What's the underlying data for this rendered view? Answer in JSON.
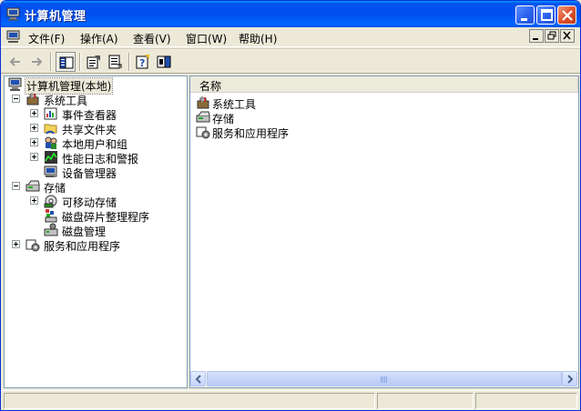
{
  "window": {
    "title": "计算机管理",
    "accent": "#0053ee",
    "close_color": "#e2532f"
  },
  "menu": {
    "items": [
      {
        "label": "文件(F)"
      },
      {
        "label": "操作(A)"
      },
      {
        "label": "查看(V)"
      },
      {
        "label": "窗口(W)"
      },
      {
        "label": "帮助(H)"
      }
    ]
  },
  "toolbar": {
    "buttons": [
      {
        "icon": "back-arrow-icon"
      },
      {
        "icon": "forward-arrow-icon"
      },
      {
        "icon": "show-hide-tree-icon"
      },
      {
        "icon": "properties-icon"
      },
      {
        "icon": "export-list-icon"
      },
      {
        "icon": "help-icon"
      },
      {
        "icon": "show-hide-action-pane-icon"
      }
    ]
  },
  "tree": {
    "root": "计算机管理(本地)",
    "system_tools": "系统工具",
    "event_viewer": "事件查看器",
    "shared_folders": "共享文件夹",
    "local_users": "本地用户和组",
    "perf_logs": "性能日志和警报",
    "device_manager": "设备管理器",
    "storage": "存储",
    "removable_storage": "可移动存储",
    "defrag": "磁盘碎片整理程序",
    "disk_mgmt": "磁盘管理",
    "services": "服务和应用程序"
  },
  "list": {
    "header_name": "名称",
    "rows": [
      {
        "label": "系统工具"
      },
      {
        "label": "存储"
      },
      {
        "label": "服务和应用程序"
      }
    ]
  }
}
